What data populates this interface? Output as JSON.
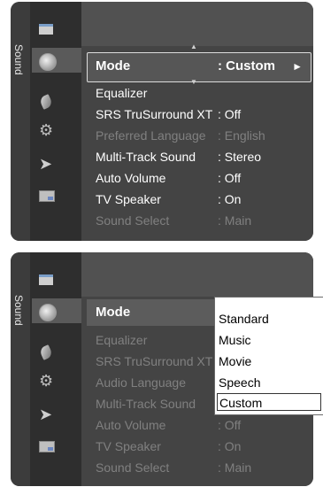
{
  "panel1": {
    "side_label": "Sound",
    "mode": {
      "label": "Mode",
      "value": ": Custom"
    },
    "rows": [
      {
        "label": "Equalizer",
        "value": ""
      },
      {
        "label": "SRS TruSurround XT",
        "value": ": Off"
      },
      {
        "label": "Preferred Language",
        "value": ": English"
      },
      {
        "label": "Multi-Track Sound",
        "value": ": Stereo"
      },
      {
        "label": "Auto Volume",
        "value": ": Off"
      },
      {
        "label": "TV Speaker",
        "value": ": On"
      },
      {
        "label": "Sound Select",
        "value": ": Main"
      }
    ]
  },
  "panel2": {
    "side_label": "Sound",
    "mode": {
      "label": "Mode",
      "value": ":"
    },
    "rows": [
      {
        "label": "Equalizer",
        "value": ""
      },
      {
        "label": "SRS TruSurround XT",
        "value": ":"
      },
      {
        "label": "Audio Language",
        "value": ""
      },
      {
        "label": "Multi-Track Sound",
        "value": ""
      },
      {
        "label": "Auto Volume",
        "value": ": Off"
      },
      {
        "label": "TV Speaker",
        "value": ": On"
      },
      {
        "label": "Sound Select",
        "value": ": Main"
      }
    ],
    "dropdown": {
      "options": [
        "Standard",
        "Music",
        "Movie",
        "Speech",
        "Custom"
      ],
      "selected": "Custom"
    }
  },
  "icons": [
    "picture-icon",
    "sound-icon",
    "channel-icon",
    "setup-icon",
    "input-icon",
    "application-icon"
  ],
  "colors": {
    "panel_bg": "#4a4a4a",
    "icon_column": "#2e2e2e",
    "text_active": "#ffffff",
    "text_disabled": "#808080"
  }
}
